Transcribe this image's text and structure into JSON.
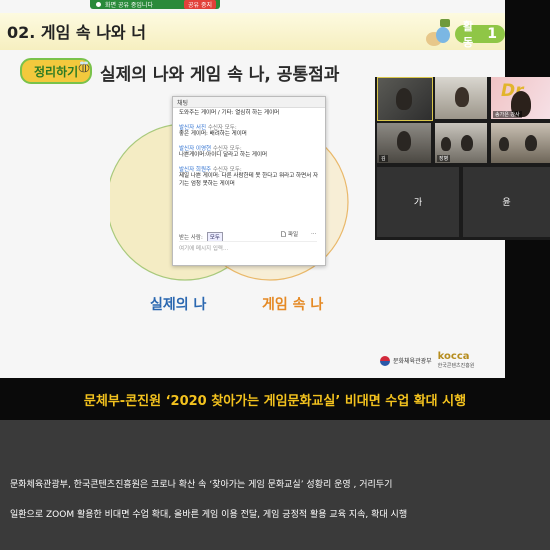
{
  "share_bar": {
    "status": "화면 공유 중입니다",
    "stop_label": "공유 중지"
  },
  "slide": {
    "title": "02. 게임 속 나와 너",
    "activity_label": "활동",
    "activity_number": "1",
    "summary_badge": "정리하기",
    "subtitle": "실제의 나와 게임 속 나, 공통점과",
    "venn_left_label": "실제의 나",
    "venn_right_label": "게임 속 나",
    "ministry_logo": "문화체육관광부",
    "kocca_logo": "kocca",
    "kocca_sub": "한국콘텐츠진흥원",
    "colors": {
      "venn_left": "#f4ecc4",
      "venn_right": "#f7ecd0",
      "real_label": "#2a67b0",
      "game_label": "#e58a25"
    }
  },
  "chat": {
    "title": "채팅",
    "messages": [
      {
        "sender": "",
        "text": "도와주는 게이머 / 기타: 열심히 하는 게이머",
        "to": ""
      },
      {
        "sender": "발신자 서진",
        "to": "수신자 모두:",
        "text": "좋은 게이머: 배려하는 게이머"
      },
      {
        "sender": "발신자 이영현",
        "to": "수신자 모두:",
        "text": "나쁜게이머:아이디 달라고 하는 게이머"
      },
      {
        "sender": "발신자 희원주",
        "to": "수신자 모두:",
        "text": "제일 나쁜 게이머: 다른 사람한테 못 한다고 뭐라고 하면서 자기는 엄청 못하는 게이머"
      }
    ],
    "to_label": "받는 사람:",
    "to_value": "모두",
    "file_label": "파일",
    "more_label": "...",
    "input_placeholder": "여기에 메시지 입력..."
  },
  "video": {
    "tiles": [
      {
        "name": ""
      },
      {
        "name": ""
      },
      {
        "name": "송가은 강사",
        "overlay_text": "Dr"
      },
      {
        "name": "김"
      },
      {
        "name": "장병"
      },
      {
        "name": ""
      },
      {
        "name": "가"
      },
      {
        "name": "윤"
      }
    ]
  },
  "headline": "문체부-콘진원 ‘2020 찾아가는 게임문화교실’ 비대면 수업 확대 시행",
  "caption": {
    "line1": "문화체육관광부, 한국콘텐츠진흥원은 코로나 확산 속 ‘찾아가는 게임 문화교실’ 성황리 운영 , 거리두기",
    "line2": "일환으로 ZOOM 활용한 비대면 수업 확대, 올바른 게임 이용 전달, 게임 긍정적 활용 교육 지속, 확대 시행"
  }
}
